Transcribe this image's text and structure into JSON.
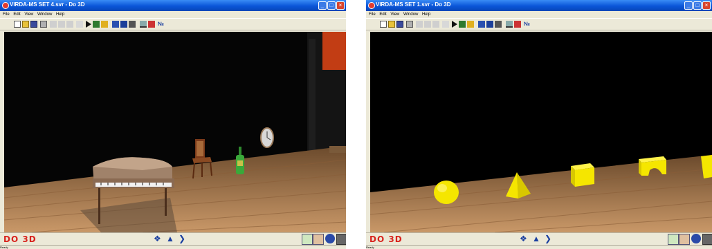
{
  "left_window": {
    "title": "VIRDA-MS SET 4.svr - Do 3D",
    "menu": [
      "File",
      "Edit",
      "View",
      "Window",
      "Help"
    ],
    "logo": "DO 3D",
    "status": "Ready",
    "objects": [
      "piano",
      "chair",
      "bottle",
      "clock",
      "stage-wall"
    ]
  },
  "right_window": {
    "title": "VIRDA-MS SET 1.svr - Do 3D",
    "menu": [
      "File",
      "Edit",
      "View",
      "Window",
      "Help"
    ],
    "logo": "DO 3D",
    "status": "Ready",
    "objects": [
      "sphere",
      "pyramid",
      "cube",
      "arch"
    ]
  },
  "colors": {
    "titlebar": "#0a55d8",
    "floor": "#a9774a",
    "object_yellow": "#f5e600",
    "logo_red": "#d8231d"
  },
  "icons": [
    "new-file-icon",
    "open-folder-icon",
    "save-icon",
    "print-icon",
    "cut-icon",
    "copy-icon",
    "paste-icon",
    "undo-icon",
    "play-icon",
    "book-icon",
    "walk-icon",
    "fly-icon",
    "camera-icon",
    "ruler-icon",
    "house-icon",
    "help-icon"
  ]
}
